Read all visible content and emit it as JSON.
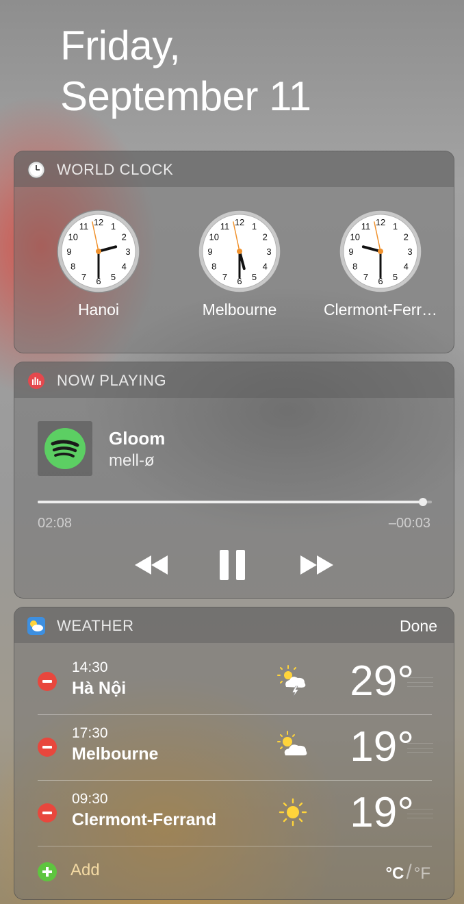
{
  "date": {
    "line1": "Friday,",
    "line2": "September 11"
  },
  "world_clock": {
    "title": "WORLD CLOCK",
    "clocks": [
      {
        "city": "Hanoi",
        "hour": 2,
        "minute": 30,
        "second": 58
      },
      {
        "city": "Melbourne",
        "hour": 5,
        "minute": 30,
        "second": 58
      },
      {
        "city": "Clermont-Ferr…",
        "hour": 9,
        "minute": 30,
        "second": 58
      }
    ]
  },
  "now_playing": {
    "title": "NOW PLAYING",
    "track": "Gloom",
    "artist": "mell-ø",
    "elapsed": "02:08",
    "remaining": "–00:03",
    "progress": 0.977
  },
  "weather": {
    "title": "WEATHER",
    "done_label": "Done",
    "rows": [
      {
        "time": "14:30",
        "city": "Hà Nội",
        "temp": "29°",
        "icon": "thunderstorm-sun-icon"
      },
      {
        "time": "17:30",
        "city": "Melbourne",
        "temp": "19°",
        "icon": "partly-cloudy-icon"
      },
      {
        "time": "09:30",
        "city": "Clermont-Ferrand",
        "temp": "19°",
        "icon": "sunny-icon"
      }
    ],
    "add_label": "Add",
    "unit_c": "°C",
    "unit_slash": "/",
    "unit_f": "°F"
  },
  "colors": {
    "accent_green": "#5ec53f",
    "delete_red": "#e8473d",
    "spotify_green": "#5ccf63"
  }
}
